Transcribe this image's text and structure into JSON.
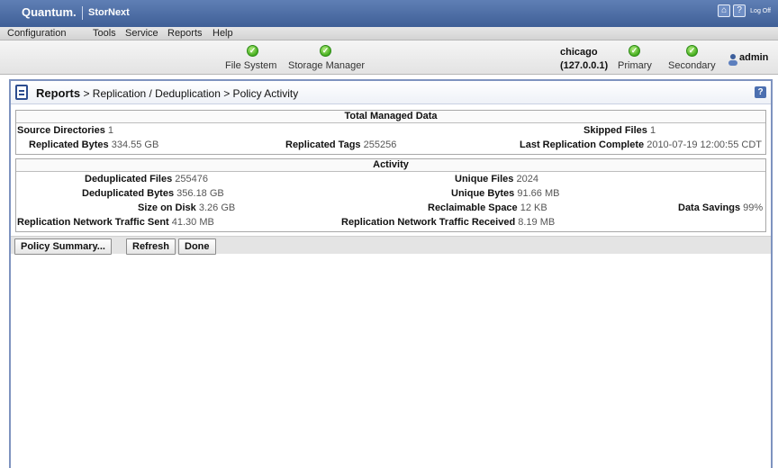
{
  "brand": {
    "name": "Quantum.",
    "product": "StorNext",
    "logoff": "Log Off"
  },
  "menu": [
    "Configuration",
    "Tools",
    "Service",
    "Reports",
    "Help"
  ],
  "status": {
    "file_system": "File System",
    "storage_manager": "Storage Manager",
    "host": "chicago",
    "ip": "(127.0.0.1)",
    "primary": "Primary",
    "secondary": "Secondary",
    "user": "admin"
  },
  "breadcrumb": {
    "root": "Reports",
    "rest": " > Replication / Deduplication > Policy Activity"
  },
  "total_managed_data": {
    "title": "Total Managed Data",
    "source_directories": {
      "label": "Source Directories",
      "value": "1"
    },
    "skipped_files": {
      "label": "Skipped Files",
      "value": "1"
    },
    "replicated_bytes": {
      "label": "Replicated Bytes",
      "value": "334.55 GB"
    },
    "replicated_tags": {
      "label": "Replicated Tags",
      "value": "255256"
    },
    "last_replication": {
      "label": "Last Replication Complete",
      "value": "2010-07-19 12:00:55 CDT"
    }
  },
  "activity": {
    "title": "Activity",
    "deduplicated_files": {
      "label": "Deduplicated Files",
      "value": "255476"
    },
    "unique_files": {
      "label": "Unique Files",
      "value": "2024"
    },
    "deduplicated_bytes": {
      "label": "Deduplicated Bytes",
      "value": "356.18 GB"
    },
    "unique_bytes": {
      "label": "Unique Bytes",
      "value": "91.66 MB"
    },
    "size_on_disk": {
      "label": "Size on Disk",
      "value": "3.26 GB"
    },
    "reclaimable_space": {
      "label": "Reclaimable Space",
      "value": "12 KB"
    },
    "data_savings": {
      "label": "Data Savings",
      "value": "99%"
    },
    "traffic_sent": {
      "label": "Replication Network Traffic Sent",
      "value": "41.30 MB"
    },
    "traffic_received": {
      "label": "Replication Network Traffic Received",
      "value": "8.19 MB"
    }
  },
  "buttons": {
    "policy_summary": "Policy Summary...",
    "refresh": "Refresh",
    "done": "Done"
  }
}
